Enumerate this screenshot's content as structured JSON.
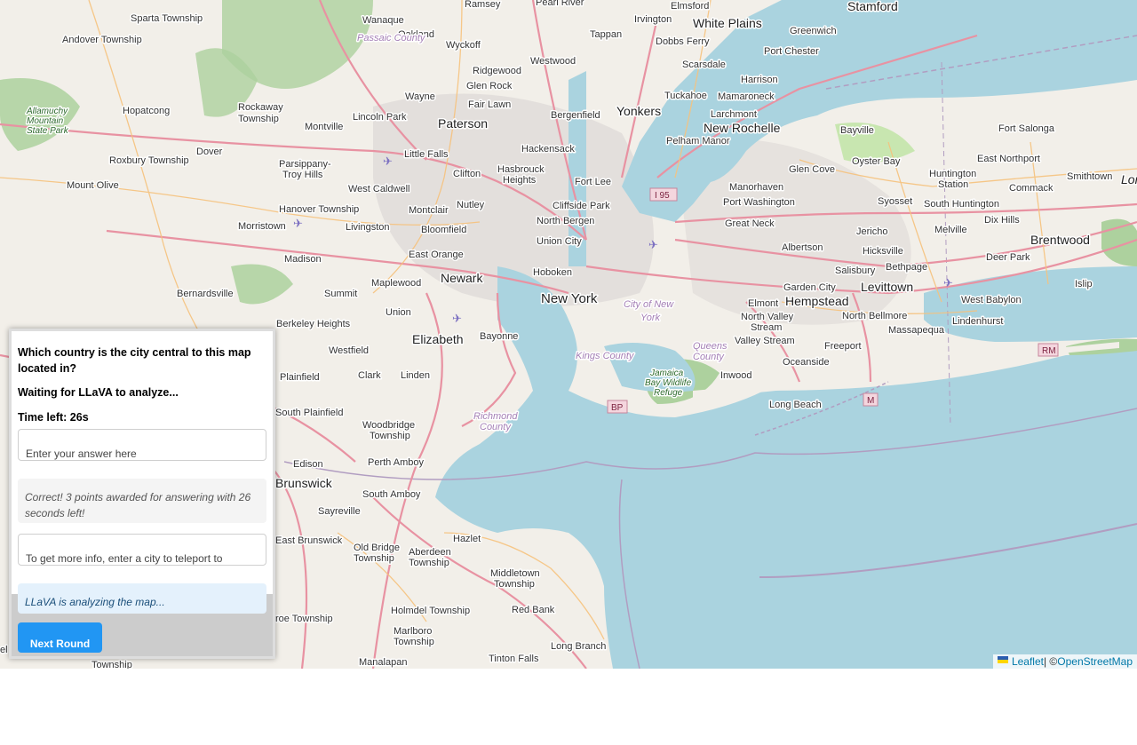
{
  "map": {
    "labels": {
      "sparta": "Sparta Township",
      "wanaque": "Wanaque",
      "oakland": "Oakland",
      "ramsey": "Ramsey",
      "pearl_river": "Pearl River",
      "elmsford": "Elmsford",
      "irvington": "Irvington",
      "white_plains": "White Plains",
      "stamford": "Stamford",
      "greenwich": "Greenwich",
      "andover": "Andover Township",
      "passaic_county": "Passaic County",
      "wyckoff": "Wyckoff",
      "tappan": "Tappan",
      "dobbs_ferry": "Dobbs Ferry",
      "port_chester": "Port Chester",
      "scarsdale": "Scarsdale",
      "ridgewood": "Ridgewood",
      "westwood": "Westwood",
      "glen_rock": "Glen Rock",
      "harrison": "Harrison",
      "tuckahoe": "Tuckahoe",
      "mamaroneck": "Mamaroneck",
      "allamuchy": "Allamuchy Mountain State Park",
      "hopatcong": "Hopatcong",
      "rockaway": "Rockaway Township",
      "wayne": "Wayne",
      "fair_lawn": "Fair Lawn",
      "yonkers": "Yonkers",
      "larchmont": "Larchmont",
      "lincoln_park": "Lincoln Park",
      "bergenfield": "Bergenfield",
      "paterson": "Paterson",
      "montville": "Montville",
      "new_rochelle": "New Rochelle",
      "pelham_manor": "Pelham Manor",
      "bayville": "Bayville",
      "fort_salonga": "Fort Salonga",
      "hackensack": "Hackensack",
      "dover": "Dover",
      "little_falls": "Little Falls",
      "roxbury": "Roxbury Township",
      "parsippany": "Parsippany-Troy Hills",
      "clifton": "Clifton",
      "hasbrouck": "Hasbrouck Heights",
      "oyster_bay": "Oyster Bay",
      "east_northport": "East Northport",
      "glen_cove": "Glen Cove",
      "huntington_station": "Huntington Station",
      "smithtown": "Smithtown",
      "mount_olive": "Mount Olive",
      "west_caldwell": "West Caldwell",
      "fort_lee": "Fort Lee",
      "i95": "I 95",
      "manorhaven": "Manorhaven",
      "commack": "Commack",
      "hanover": "Hanover Township",
      "montclair": "Montclair",
      "nutley": "Nutley",
      "cliffside": "Cliffside Park",
      "port_washington": "Port Washington",
      "syosset": "Syosset",
      "south_huntington": "South Huntington",
      "dix_hills": "Dix Hills",
      "morristown": "Morristown",
      "livingston": "Livingston",
      "bloomfield": "Bloomfield",
      "north_bergen": "North Bergen",
      "great_neck": "Great Neck",
      "jericho": "Jericho",
      "melville": "Melville",
      "brentwood": "Brentwood",
      "union_city": "Union City",
      "albertson": "Albertson",
      "hicksville": "Hicksville",
      "east_orange": "East Orange",
      "madison": "Madison",
      "deer_park": "Deer Park",
      "salisbury": "Salisbury",
      "bethpage": "Bethpage",
      "hoboken": "Hoboken",
      "newark": "Newark",
      "maplewood": "Maplewood",
      "garden_city": "Garden City",
      "levittown": "Levittown",
      "bernardsville": "Bernardsville",
      "summit": "Summit",
      "west_babylon": "West Babylon",
      "islip": "Islip",
      "new_york": "New York",
      "city_of_ny": "City of New York",
      "elmont": "Elmont",
      "hempstead": "Hempstead",
      "union": "Union",
      "north_valley_stream": "North Valley Stream",
      "north_bellmore": "North Bellmore",
      "lindenhurst": "Lindenhurst",
      "berkeley": "Berkeley Heights",
      "elizabeth": "Elizabeth",
      "bayonne": "Bayonne",
      "massapequa": "Massapequa",
      "valley_stream": "Valley Stream",
      "freeport": "Freeport",
      "westfield": "Westfield",
      "queens_county": "Queens County",
      "rm": "RM",
      "kings_county": "Kings County",
      "clark": "Clark",
      "linden": "Linden",
      "oceanside": "Oceanside",
      "plainfield": "Plainfield",
      "jamaica_bay": "Jamaica Bay Wildlife Refuge",
      "inwood": "Inwood",
      "m_shield": "M",
      "bp_shield": "BP",
      "long_beach": "Long Beach",
      "south_plainfield": "South Plainfield",
      "richmond_county": "Richmond County",
      "woodbridge": "Woodbridge Township",
      "edison": "Edison",
      "perth_amboy": "Perth Amboy",
      "brunswick": "Brunswick",
      "south_amboy": "South Amboy",
      "sayreville": "Sayreville",
      "hazlet": "Hazlet",
      "east_brunswick": "East Brunswick",
      "old_bridge": "Old Bridge Township",
      "aberdeen": "Aberdeen Township",
      "middletown": "Middletown Township",
      "red_bank": "Red Bank",
      "holmdel": "Holmdel Township",
      "roe_township": "roe Township",
      "marlboro": "Marlboro Township",
      "long_branch": "Long Branch",
      "tinton_falls": "Tinton Falls",
      "township": "Township",
      "manalapan": "Manalapan",
      "lon": "Lon",
      "el": "el"
    },
    "colors": {
      "water": "#aad3df",
      "land": "#f2efe9",
      "park": "#c8e6b0",
      "forest": "#add19e",
      "motorway": "#e892a2",
      "primary": "#fcd6a4",
      "urban": "#e0dfdf"
    }
  },
  "attribution": {
    "leaflet": "Leaflet",
    "separator": " | © ",
    "osm": "OpenStreetMap"
  },
  "game": {
    "question": "Which country is the city central to this map located in?",
    "status": "Waiting for LLaVA to analyze...",
    "timer": "Time left: 26s",
    "answer_placeholder": "Enter your answer here",
    "feedback": "Correct! 3 points awarded for answering with 26 seconds left!",
    "teleport_placeholder": "To get more info, enter a city to teleport to",
    "llava_status": "LLaVA is analyzing the map...",
    "next_button": "Next Round"
  }
}
